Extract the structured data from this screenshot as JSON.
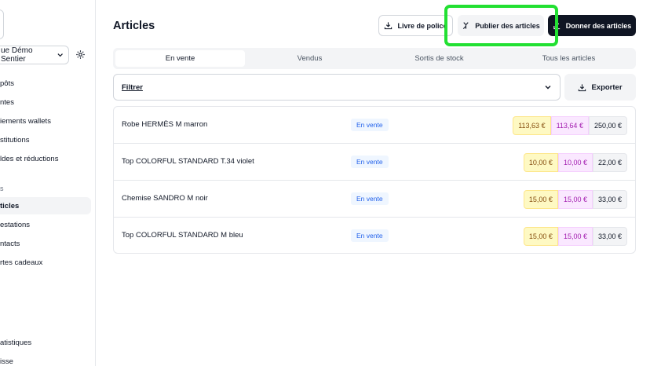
{
  "sidebar": {
    "store_name": "ue Démo Sentier",
    "items": [
      {
        "label": "pôts"
      },
      {
        "label": "ntes"
      },
      {
        "label": "iements wallets"
      },
      {
        "label": "stitutions"
      },
      {
        "label": "ldes et réductions"
      },
      {
        "label": "s"
      },
      {
        "label": "ticles"
      },
      {
        "label": "estations"
      },
      {
        "label": "ntacts"
      },
      {
        "label": "rtes cadeaux"
      },
      {
        "label": "atistiques"
      },
      {
        "label": "isse"
      }
    ]
  },
  "header": {
    "title": "Articles",
    "btn_police": "Livre de police",
    "btn_publish": "Publier des articles",
    "btn_give": "Donner des articles"
  },
  "tabs": [
    "En vente",
    "Vendus",
    "Sortis de stock",
    "Tous les articles"
  ],
  "filter": {
    "label": "Filtrer",
    "export": "Exporter"
  },
  "rows": [
    {
      "name": "Robe HERMÈS M marron",
      "status": "En vente",
      "p1": "113,63 €",
      "p2": "113,64 €",
      "p3": "250,00 €"
    },
    {
      "name": "Top COLORFUL STANDARD T.34 violet",
      "status": "En vente",
      "p1": "10,00 €",
      "p2": "10,00 €",
      "p3": "22,00 €"
    },
    {
      "name": "Chemise SANDRO M noir",
      "status": "En vente",
      "p1": "15,00 €",
      "p2": "15,00 €",
      "p3": "33,00 €"
    },
    {
      "name": "Top COLORFUL STANDARD M bleu",
      "status": "En vente",
      "p1": "15,00 €",
      "p2": "15,00 €",
      "p3": "33,00 €"
    }
  ],
  "colors": {
    "highlight": "#22e032",
    "primary_dark": "#0f1523",
    "badge_blue": "#2563eb"
  }
}
